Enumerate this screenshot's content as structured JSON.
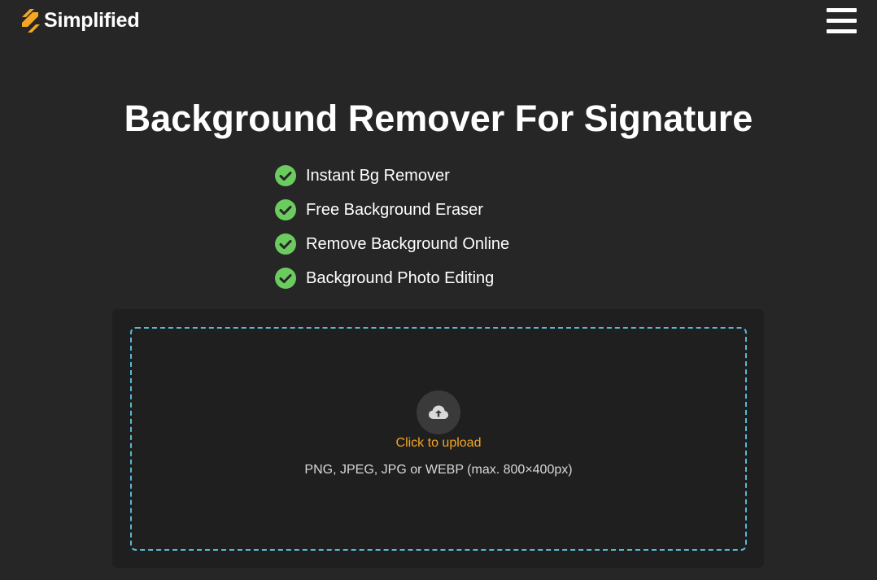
{
  "header": {
    "brand_name": "Simplified",
    "logo_icon": "simplified-logo-icon",
    "menu_icon": "hamburger-menu-icon"
  },
  "hero": {
    "title": "Background Remover For Signature"
  },
  "features": [
    {
      "label": "Instant Bg Remover",
      "icon": "check-circle-icon"
    },
    {
      "label": "Free Background Eraser",
      "icon": "check-circle-icon"
    },
    {
      "label": "Remove Background Online",
      "icon": "check-circle-icon"
    },
    {
      "label": "Background Photo Editing",
      "icon": "check-circle-icon"
    }
  ],
  "upload": {
    "icon": "cloud-upload-icon",
    "action_label": "Click to upload",
    "hint": "PNG, JPEG, JPG or WEBP (max. 800×400px)"
  },
  "colors": {
    "background": "#262626",
    "panel": "#1f1f1f",
    "accent_orange": "#f5a623",
    "check_green": "#6ccb5f",
    "dropzone_border": "#5ab8d6"
  }
}
